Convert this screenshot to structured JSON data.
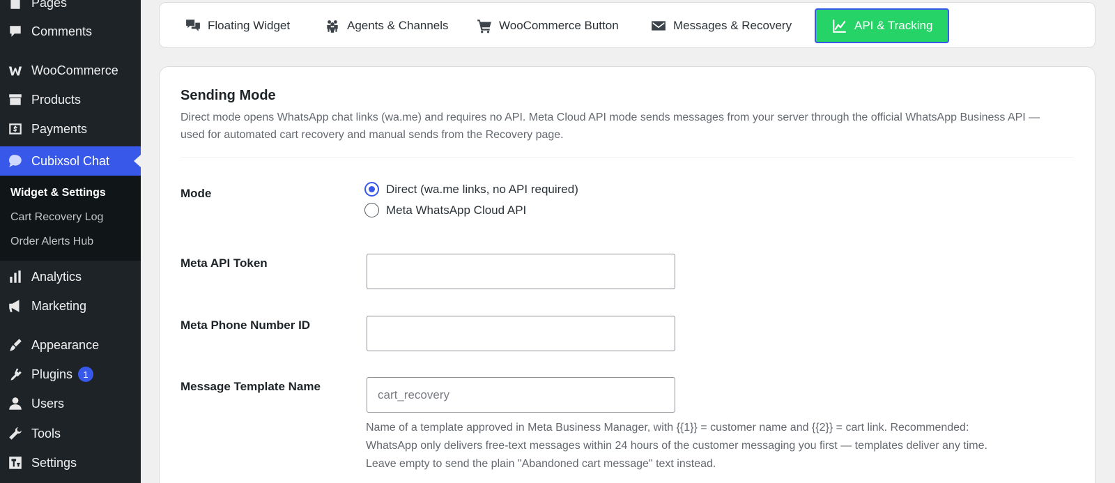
{
  "sidebar": {
    "items": [
      {
        "label": "Pages",
        "icon": "pages-icon"
      },
      {
        "label": "Comments",
        "icon": "comments-icon"
      },
      {
        "label": "WooCommerce",
        "icon": "woocommerce-icon"
      },
      {
        "label": "Products",
        "icon": "products-icon"
      },
      {
        "label": "Payments",
        "icon": "payments-icon"
      },
      {
        "label": "Cubixsol Chat",
        "icon": "chat-bubble-icon"
      },
      {
        "label": "Analytics",
        "icon": "analytics-icon"
      },
      {
        "label": "Marketing",
        "icon": "megaphone-icon"
      },
      {
        "label": "Appearance",
        "icon": "paintbrush-icon"
      },
      {
        "label": "Plugins",
        "icon": "plugin-icon",
        "badge": "1"
      },
      {
        "label": "Users",
        "icon": "users-icon"
      },
      {
        "label": "Tools",
        "icon": "wrench-icon"
      },
      {
        "label": "Settings",
        "icon": "settings-icon"
      }
    ],
    "submenu": [
      "Widget & Settings",
      "Cart Recovery Log",
      "Order Alerts Hub"
    ],
    "active_color": "#3858e9"
  },
  "tabs": [
    {
      "label": "Floating Widget",
      "icon": "chat-bubbles-icon"
    },
    {
      "label": "Agents & Channels",
      "icon": "group-icon"
    },
    {
      "label": "WooCommerce Button",
      "icon": "cart-icon"
    },
    {
      "label": "Messages & Recovery",
      "icon": "envelope-icon"
    },
    {
      "label": "API & Tracking",
      "icon": "chart-line-icon",
      "active": true
    }
  ],
  "tab_active_color": "#25d366",
  "main": {
    "title": "Sending Mode",
    "description": "Direct mode opens WhatsApp chat links (wa.me) and requires no API. Meta Cloud API mode sends messages from your server through the official WhatsApp Business API — used for automated cart recovery and manual sends from the Recovery page.",
    "mode": {
      "label": "Mode",
      "options": [
        "Direct (wa.me links, no API required)",
        "Meta WhatsApp Cloud API"
      ],
      "selected": "Direct (wa.me links, no API required)"
    },
    "token": {
      "label": "Meta API Token",
      "value": "",
      "placeholder": ""
    },
    "phone_id": {
      "label": "Meta Phone Number ID",
      "value": "",
      "placeholder": ""
    },
    "template": {
      "label": "Message Template Name",
      "value": "",
      "placeholder": "cart_recovery",
      "help": [
        "Name of a template approved in Meta Business Manager, with {{1}} = customer name and {{2}} = cart link. Recommended:",
        "WhatsApp only delivers free-text messages within 24 hours of the customer messaging you first — templates deliver any time.",
        "Leave empty to send the plain \"Abandoned cart message\" text instead."
      ]
    }
  }
}
